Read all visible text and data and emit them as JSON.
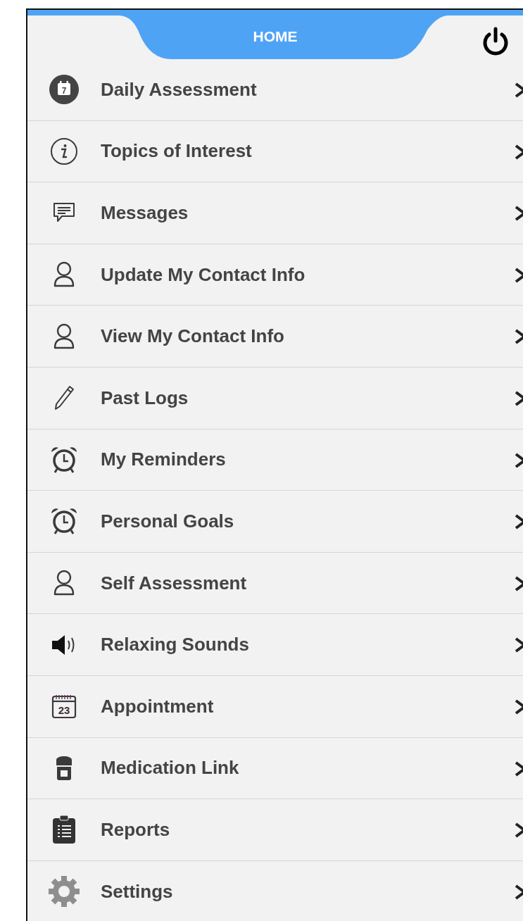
{
  "header": {
    "title": "HOME"
  },
  "menu": [
    {
      "label": "Daily Assessment",
      "kind": "dayplanner",
      "icon_text": "7"
    },
    {
      "label": "Topics of Interest",
      "kind": "info"
    },
    {
      "label": "Messages",
      "kind": "message"
    },
    {
      "label": "Update My Contact Info",
      "kind": "contact"
    },
    {
      "label": "View My Contact Info",
      "kind": "contact"
    },
    {
      "label": "Past Logs",
      "kind": "logs"
    },
    {
      "label": "My Reminders",
      "kind": "reminder"
    },
    {
      "label": "Personal Goals",
      "kind": "reminder"
    },
    {
      "label": "Self Assessment",
      "kind": "contact"
    },
    {
      "label": "Relaxing Sounds",
      "kind": "sound"
    },
    {
      "label": "Appointment",
      "kind": "calendar",
      "icon_text": "23"
    },
    {
      "label": "Medication Link",
      "kind": "medication"
    },
    {
      "label": "Reports",
      "kind": "reports"
    },
    {
      "label": "Settings",
      "kind": "settings"
    }
  ]
}
